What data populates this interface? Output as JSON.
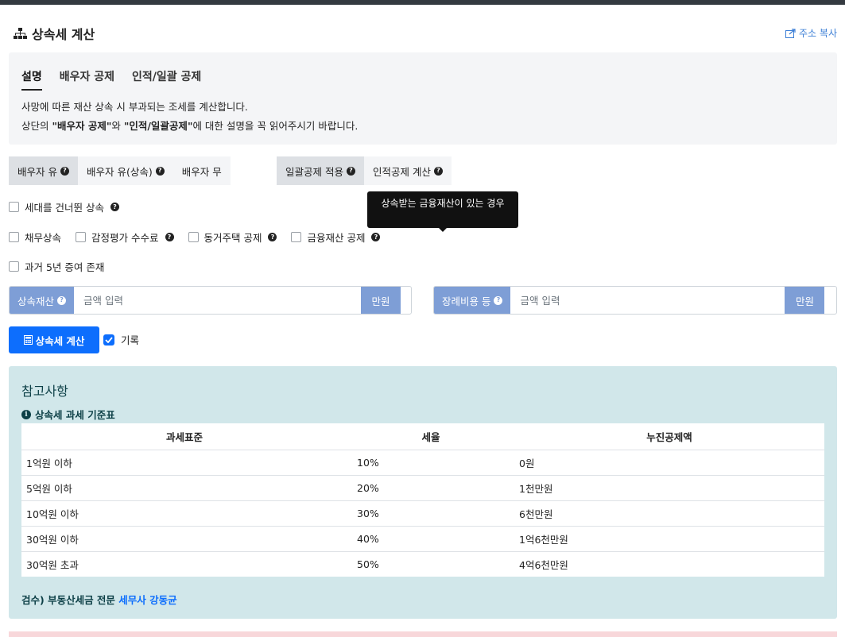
{
  "header": {
    "title": "상속세 계산",
    "copy_label": "주소 복사"
  },
  "description": {
    "tabs": [
      {
        "label": "설명",
        "active": true
      },
      {
        "label": "배우자 공제",
        "active": false
      },
      {
        "label": "인적/일괄 공제",
        "active": false
      }
    ],
    "line1": "사망에 따른 재산 상속 시 부과되는 조세를 계산합니다.",
    "line2_prefix": "상단의 ",
    "line2_bold1": "\"배우자 공제\"",
    "line2_mid": "와 ",
    "line2_bold2": "\"인적/일괄공제\"",
    "line2_suffix": "에 대한 설명을 꼭 읽어주시기 바랍니다."
  },
  "spouse_options": [
    {
      "label": "배우자 유",
      "help": true,
      "active": true
    },
    {
      "label": "배우자 유(상속)",
      "help": true,
      "active": false
    },
    {
      "label": "배우자 무",
      "help": false,
      "active": false
    }
  ],
  "deduction_options": [
    {
      "label": "일괄공제 적용",
      "help": true,
      "active": true
    },
    {
      "label": "인적공제 계산",
      "help": true,
      "active": false
    }
  ],
  "tooltip": "상속받는 금융재산이 있는 경우",
  "checkboxes": {
    "skip_generation": "세대를 건너뛴 상속",
    "debt": "채무상속",
    "appraisal_fee": "감정평가 수수료",
    "cohabiting_house": "동거주택 공제",
    "financial_asset": "금융재산 공제",
    "past_gift": "과거 5년 증여 존재"
  },
  "inputs": {
    "estate_label": "상속재산",
    "estate_placeholder": "금액 입력",
    "estate_unit": "만원",
    "funeral_label": "장례비용 등",
    "funeral_placeholder": "금액 입력",
    "funeral_unit": "만원"
  },
  "calc_button": "상속세 계산",
  "record_label": "기록",
  "reference": {
    "title": "참고사항",
    "subtitle": "상속세 과세 기준표",
    "columns": [
      "과세표준",
      "세율",
      "누진공제액"
    ],
    "rows": [
      [
        "1억원 이하",
        "10%",
        "0원"
      ],
      [
        "5억원 이하",
        "20%",
        "1천만원"
      ],
      [
        "10억원 이하",
        "30%",
        "6천만원"
      ],
      [
        "30억원 이하",
        "40%",
        "1억6천만원"
      ],
      [
        "30억원 초과",
        "50%",
        "4억6천만원"
      ]
    ],
    "reviewer_prefix": "검수) 부동산세금 전문 ",
    "reviewer_name": "세무사 강동균"
  },
  "colors": {
    "primary": "#0d6efd",
    "input_addon": "#7e9ed6",
    "info_bg": "#d1e7ea",
    "desc_bg": "#f4f5f7"
  }
}
